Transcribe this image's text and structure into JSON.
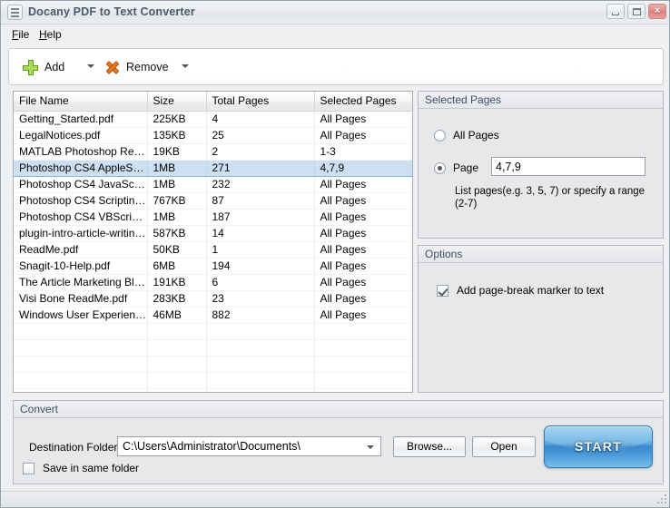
{
  "window": {
    "title": "Docany PDF to Text Converter",
    "icon": "document-list-icon",
    "minimize_label": "Minimize",
    "maximize_label": "Maximize",
    "close_label": "×"
  },
  "menubar": {
    "items": [
      {
        "label": "File",
        "mnemonic": "F"
      },
      {
        "label": "Help",
        "mnemonic": "H"
      }
    ]
  },
  "toolbar": {
    "add_label": "Add",
    "remove_label": "Remove",
    "add_icon": "green-plus-icon",
    "remove_icon": "orange-x-icon"
  },
  "filetable": {
    "columns": [
      "File Name",
      "Size",
      "Total Pages",
      "Selected Pages"
    ],
    "rows": [
      {
        "name": "Getting_Started.pdf",
        "size": "225KB",
        "total": "4",
        "selected": "All Pages",
        "is_selected": false
      },
      {
        "name": "LegalNotices.pdf",
        "size": "135KB",
        "total": "25",
        "selected": "All Pages",
        "is_selected": false
      },
      {
        "name": "MATLAB Photoshop Read ...",
        "size": "19KB",
        "total": "2",
        "selected": "1-3",
        "is_selected": false
      },
      {
        "name": "Photoshop CS4 AppleScri...",
        "size": "1MB",
        "total": "271",
        "selected": "4,7,9",
        "is_selected": true
      },
      {
        "name": "Photoshop CS4 JavaScrip...",
        "size": "1MB",
        "total": "232",
        "selected": "All Pages",
        "is_selected": false
      },
      {
        "name": "Photoshop CS4 Scripting ...",
        "size": "767KB",
        "total": "87",
        "selected": "All Pages",
        "is_selected": false
      },
      {
        "name": "Photoshop CS4 VBScript R...",
        "size": "1MB",
        "total": "187",
        "selected": "All Pages",
        "is_selected": false
      },
      {
        "name": "plugin-intro-article-writing...",
        "size": "587KB",
        "total": "14",
        "selected": "All Pages",
        "is_selected": false
      },
      {
        "name": "ReadMe.pdf",
        "size": "50KB",
        "total": "1",
        "selected": "All Pages",
        "is_selected": false
      },
      {
        "name": "Snagit-10-Help.pdf",
        "size": "6MB",
        "total": "194",
        "selected": "All Pages",
        "is_selected": false
      },
      {
        "name": "The Article Marketing Blue...",
        "size": "191KB",
        "total": "6",
        "selected": "All Pages",
        "is_selected": false
      },
      {
        "name": "Visi Bone ReadMe.pdf",
        "size": "283KB",
        "total": "23",
        "selected": "All Pages",
        "is_selected": false
      },
      {
        "name": "Windows User Experience...",
        "size": "46MB",
        "total": "882",
        "selected": "All Pages",
        "is_selected": false
      }
    ],
    "empty_row_count": 6
  },
  "selected_pages": {
    "title": "Selected Pages",
    "all_pages_label": "All Pages",
    "all_pages_checked": false,
    "page_label": "Page",
    "page_checked": true,
    "page_value": "4,7,9",
    "hint": "List pages(e.g. 3, 5, 7)  or specify a  range (2-7)"
  },
  "options": {
    "title": "Options",
    "page_break_label": "Add page-break marker to text",
    "page_break_checked": true
  },
  "convert": {
    "title": "Convert",
    "destination_label": "Destination Folder:",
    "destination_value": "C:\\Users\\Administrator\\Documents\\",
    "save_same_folder_label": "Save in same folder",
    "save_same_folder_checked": false,
    "browse_label": "Browse...",
    "open_label": "Open",
    "start_label": "START"
  },
  "colors": {
    "accent_blue": "#3b88cc",
    "selection_blue": "#cde0f2",
    "title_text": "#4a5a6b",
    "add_icon_green": "#8cc63f",
    "remove_icon_orange": "#e87722",
    "panel_bg": "#e6e8ea"
  }
}
